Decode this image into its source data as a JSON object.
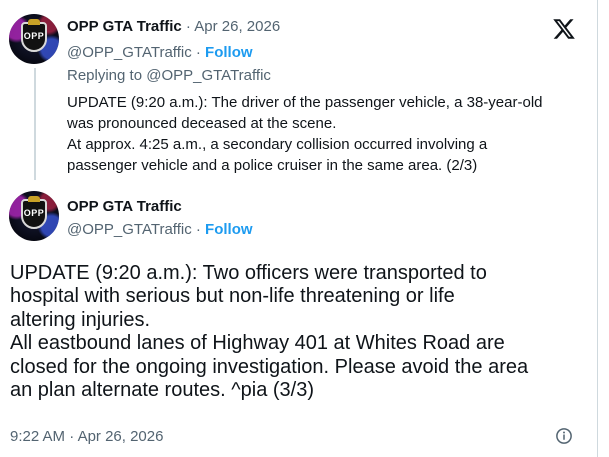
{
  "tweet1": {
    "display_name": "OPP GTA Traffic",
    "separator": " · ",
    "date": "Apr 26, 2026",
    "handle": "@OPP_GTATraffic",
    "follow_sep": " · ",
    "follow_label": "Follow",
    "replying_prefix": "Replying to ",
    "replying_handle": "@OPP_GTATraffic",
    "lines": [
      "UPDATE (9:20 a.m.): The driver of the passenger vehicle, a 38-year-old",
      "was pronounced deceased at the scene.",
      "At approx. 4:25 a.m., a secondary collision occurred involving a",
      "passenger vehicle and a police cruiser in the same area. (2/3)"
    ]
  },
  "tweet2": {
    "display_name": "OPP GTA Traffic",
    "handle": "@OPP_GTATraffic",
    "follow_sep": " · ",
    "follow_label": "Follow",
    "lines": [
      "UPDATE (9:20 a.m.): Two officers were transported to",
      "hospital with serious but non-life threatening or life",
      "altering injuries.",
      "All eastbound lanes of Highway 401 at Whites Road are",
      "closed for the ongoing investigation. Please avoid the area",
      "an plan alternate routes. ^pia (3/3)"
    ],
    "time": "9:22 AM",
    "meta_sep": " · ",
    "date": "Apr 26, 2026"
  },
  "avatar_text": "OPP",
  "icons": {
    "logo": "x-logo-icon",
    "info": "info-icon"
  },
  "colors": {
    "text": "#0f1419",
    "muted": "#536471",
    "link": "#1d9bf0"
  }
}
